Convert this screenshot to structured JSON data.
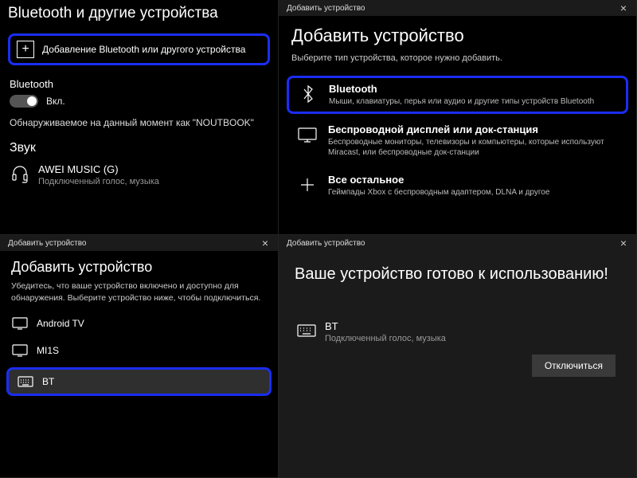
{
  "panelA": {
    "title": "Bluetooth и другие устройства",
    "add_label": "Добавление Bluetooth или другого устройства",
    "bt_section": "Bluetooth",
    "toggle_label": "Вкл.",
    "discoverable": "Обнаруживаемое на данный момент как \"NOUTBOOK\"",
    "sound_heading": "Звук",
    "device": {
      "name": "AWEI MUSIC (G)",
      "status": "Подключенный голос, музыка"
    }
  },
  "panelB": {
    "window_title": "Добавить устройство",
    "heading": "Добавить устройство",
    "subtitle": "Выберите тип устройства, которое нужно добавить.",
    "options": [
      {
        "title": "Bluetooth",
        "sub": "Мыши, клавиатуры, перья или аудио и другие типы устройств Bluetooth"
      },
      {
        "title": "Беспроводной дисплей или док-станция",
        "sub": "Беспроводные мониторы, телевизоры и компьютеры, которые используют Miracast, или беспроводные док-станции"
      },
      {
        "title": "Все остальное",
        "sub": "Геймпады Xbox с беспроводным адаптером, DLNA и другое"
      }
    ]
  },
  "panelC": {
    "window_title": "Добавить устройство",
    "heading": "Добавить устройство",
    "subtitle": "Убедитесь, что ваше устройство включено и доступно для обнаружения. Выберите устройство ниже, чтобы подключиться.",
    "items": [
      {
        "name": "Android TV"
      },
      {
        "name": "MI1S"
      },
      {
        "name": "BT"
      }
    ]
  },
  "panelD": {
    "window_title": "Добавить устройство",
    "heading": "Ваше устройство готово к использованию!",
    "device": {
      "name": "BT",
      "status": "Подключенный голос, музыка"
    },
    "disconnect": "Отключиться"
  }
}
